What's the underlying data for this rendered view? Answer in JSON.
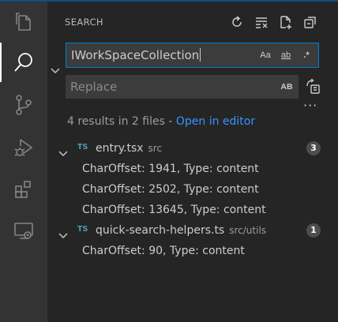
{
  "colors": {
    "accent": "#007fd4",
    "link": "#3794ff",
    "ts_icon": "#519aba",
    "badge_bg": "#4d4d4d"
  },
  "activity_bar": [
    {
      "name": "explorer-icon",
      "icon": "files"
    },
    {
      "name": "search-icon",
      "icon": "search",
      "active": true
    },
    {
      "name": "source-control-icon",
      "icon": "git-branch"
    },
    {
      "name": "run-debug-icon",
      "icon": "debug"
    },
    {
      "name": "extensions-icon",
      "icon": "extensions"
    },
    {
      "name": "remote-explorer-icon",
      "icon": "remote"
    }
  ],
  "panel": {
    "title": "SEARCH",
    "actions": [
      "refresh-icon",
      "clear-results-icon",
      "new-search-editor-icon",
      "collapse-all-icon"
    ]
  },
  "search": {
    "value": "IWorkSpaceCollection",
    "options": {
      "match_case": "Aa",
      "whole_word": "ab",
      "regex": ".*"
    }
  },
  "replace": {
    "placeholder": "Replace",
    "preserve_case": "AB"
  },
  "results": {
    "summary": "4 results in 2 files - ",
    "open_in_editor": "Open in editor",
    "files": [
      {
        "lang": "TS",
        "name": "entry.tsx",
        "path": "src",
        "count": "3",
        "matches": [
          "CharOffset: 1941, Type: content",
          "CharOffset: 2502, Type: content",
          "CharOffset: 13645, Type: content"
        ]
      },
      {
        "lang": "TS",
        "name": "quick-search-helpers.ts",
        "path": "src/utils",
        "count": "1",
        "matches": [
          "CharOffset: 90, Type: content"
        ]
      }
    ]
  }
}
